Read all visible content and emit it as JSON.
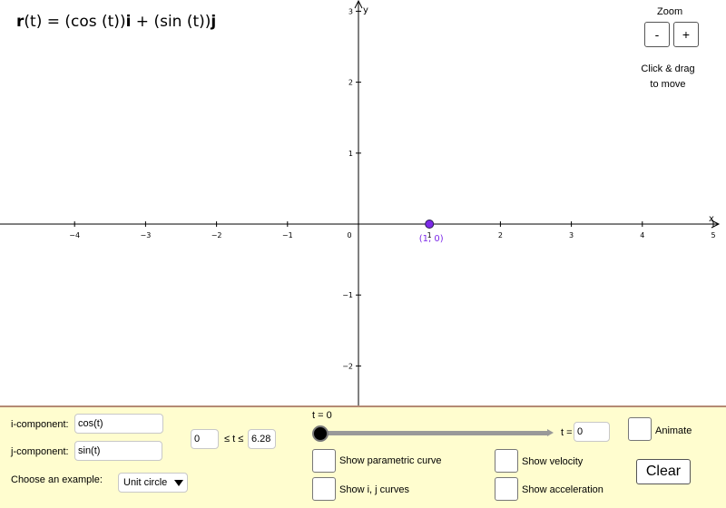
{
  "formula": {
    "r": "r",
    "arg": "(t) = (cos (t))",
    "i": "i",
    "mid": " + (sin (t))",
    "j": "j"
  },
  "zoom": {
    "label": "Zoom",
    "minus": "-",
    "plus": "+",
    "hint_line1": "Click & drag",
    "hint_line2": "to move"
  },
  "graph": {
    "x_axis_label": "x",
    "y_axis_label": "y",
    "x_ticks": [
      "−4",
      "−3",
      "−2",
      "−1",
      "1",
      "2",
      "3",
      "4",
      "5"
    ],
    "y_ticks": [
      "3",
      "2",
      "1",
      "−1",
      "−2"
    ],
    "origin_label": "0",
    "point_label": "(1, 0)",
    "point": {
      "x": 1,
      "y": 0
    },
    "point_color": "#7d2ae8"
  },
  "controls": {
    "i_component_label": "i-component:",
    "i_component_value": "cos(t)",
    "j_component_label": "j-component:",
    "j_component_value": "sin(t)",
    "t_min": "0",
    "range_label": "≤ t ≤",
    "t_max": "6.28",
    "example_label": "Choose an example:",
    "example_selected": "Unit circle",
    "slider_label": "t = 0",
    "slider_value": 0,
    "t_value_label": "t =",
    "t_value": "0",
    "animate_label": "Animate",
    "parametric_label": "Show parametric curve",
    "ij_curves_label": "Show i, j curves",
    "velocity_label": "Show velocity",
    "acceleration_label": "Show acceleration",
    "clear_label": "Clear"
  },
  "colors": {
    "panel_bg": "#fffdcf",
    "panel_border": "#b48a73",
    "point": "#7d2ae8"
  }
}
